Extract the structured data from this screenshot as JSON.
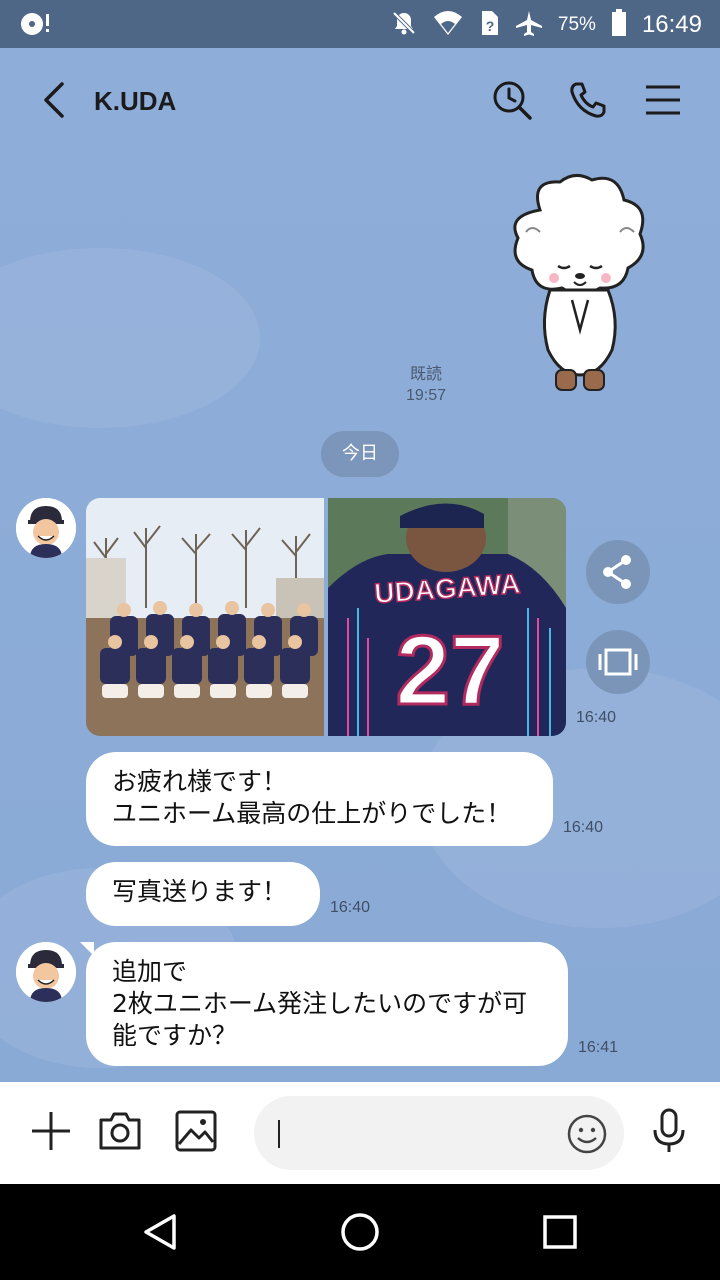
{
  "status_bar": {
    "battery": "75%",
    "clock": "16:49"
  },
  "header": {
    "title": "K.UDA"
  },
  "messages": {
    "read_label": "既読",
    "sticker_time": "19:57",
    "date_divider": "今日",
    "photo_time": "16:40",
    "jersey_name": "UDAGAWA",
    "jersey_number": "27",
    "msg1": {
      "line1": "お疲れ様です！",
      "line2": "ユニホーム最高の仕上がりでした！",
      "time": "16:40"
    },
    "msg2": {
      "text": "写真送ります！",
      "time": "16:40"
    },
    "msg3": {
      "line1": "追加で",
      "line2": "2枚ユニホーム発注したいのですが可",
      "line3": "能ですか？",
      "time": "16:41"
    }
  },
  "composer": {
    "placeholder": ""
  },
  "colors": {
    "chat_bg": "#8facd7",
    "bubble": "#ffffff",
    "status_bar": "#4e6787",
    "date_pill": "#7c95ba"
  }
}
